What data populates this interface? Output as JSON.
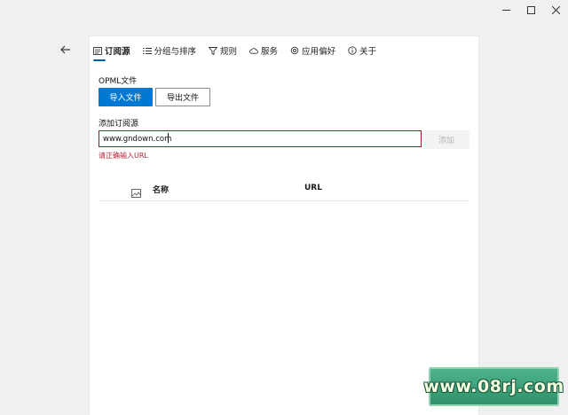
{
  "window": {
    "minimize_icon": "minimize-icon",
    "maximize_icon": "maximize-icon",
    "close_icon": "close-icon"
  },
  "nav": {
    "back_icon": "arrow-left-icon"
  },
  "tabs": [
    {
      "label": "订阅源",
      "icon": "feed-icon",
      "active": true
    },
    {
      "label": "分组与排序",
      "icon": "list-icon",
      "active": false
    },
    {
      "label": "规则",
      "icon": "filter-icon",
      "active": false
    },
    {
      "label": "服务",
      "icon": "cloud-icon",
      "active": false
    },
    {
      "label": "应用偏好",
      "icon": "gear-icon",
      "active": false
    },
    {
      "label": "关于",
      "icon": "info-icon",
      "active": false
    }
  ],
  "opml": {
    "title": "OPML文件",
    "import_label": "导入文件",
    "export_label": "导出文件"
  },
  "add_source": {
    "title": "添加订阅源",
    "input_value": "www.gndown.com",
    "add_label": "添加",
    "error_text": "请正确输入URL"
  },
  "table": {
    "columns": [
      "名称",
      "URL"
    ],
    "image_icon": "image-icon"
  },
  "watermark": {
    "text": "www.08rj.com"
  },
  "colors": {
    "accent": "#0078d4",
    "error": "#b3263a",
    "input_border_error": "#9b1c2b"
  }
}
